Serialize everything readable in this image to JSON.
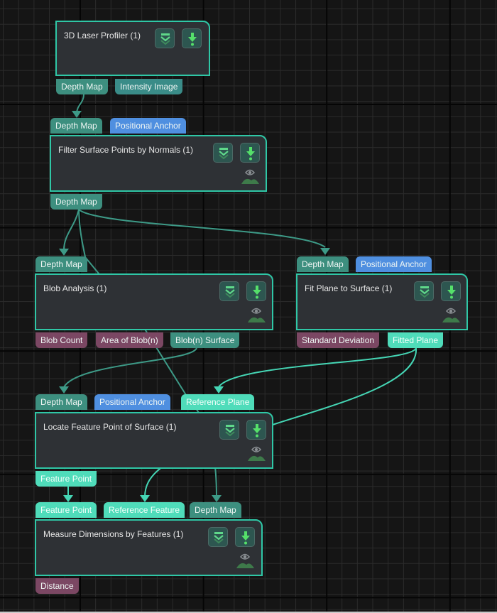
{
  "colors": {
    "background": "#151515",
    "node_fill": "#2e3135",
    "node_border": "#2fc7a6",
    "port_depth_map": "#3d8f7f",
    "port_feature": "#4fdcba",
    "port_anchor": "#4f8fe0",
    "port_numeric": "#7b4763",
    "wire_teal": "#3d9a87",
    "wire_aqua": "#45d6b5"
  },
  "icons": {
    "collapse": "chevrons-down-icon",
    "run": "download-arrow-icon",
    "preview": "eye-image-preview-icon"
  },
  "nodes": [
    {
      "id": "laser",
      "title": "3D Laser Profiler (1)",
      "inputs": [],
      "outputs": [
        "Depth Map",
        "Intensity Image"
      ],
      "has_preview": false
    },
    {
      "id": "filter",
      "title": "Filter Surface Points by Normals (1)",
      "inputs": [
        "Depth Map",
        "Positional Anchor"
      ],
      "outputs": [
        "Depth Map"
      ],
      "has_preview": true
    },
    {
      "id": "blob",
      "title": "Blob Analysis (1)",
      "inputs": [
        "Depth Map"
      ],
      "outputs": [
        "Blob Count",
        "Area of Blob(n)",
        "Blob(n) Surface"
      ],
      "has_preview": true
    },
    {
      "id": "fitplane",
      "title": "Fit Plane to Surface (1)",
      "inputs": [
        "Depth Map",
        "Positional Anchor"
      ],
      "outputs": [
        "Standard Deviation",
        "Fitted Plane"
      ],
      "has_preview": true
    },
    {
      "id": "locate",
      "title": "Locate Feature Point of Surface (1)",
      "inputs": [
        "Depth Map",
        "Positional Anchor",
        "Reference Plane"
      ],
      "outputs": [
        "Feature Point"
      ],
      "has_preview": true
    },
    {
      "id": "measure",
      "title": "Measure Dimensions by Features (1)",
      "inputs": [
        "Feature Point",
        "Reference Feature",
        "Depth Map"
      ],
      "outputs": [
        "Distance"
      ],
      "has_preview": true
    }
  ],
  "connections": [
    {
      "from": "3D Laser Profiler (1) / Depth Map",
      "to": "Filter Surface Points by Normals (1) / Depth Map"
    },
    {
      "from": "Filter Surface Points by Normals (1) / Depth Map",
      "to": "Blob Analysis (1) / Depth Map"
    },
    {
      "from": "Filter Surface Points by Normals (1) / Depth Map",
      "to": "Fit Plane to Surface (1) / Depth Map"
    },
    {
      "from": "Filter Surface Points by Normals (1) / Depth Map",
      "to": "Measure Dimensions by Features (1) / Depth Map"
    },
    {
      "from": "Blob Analysis (1) / Blob(n) Surface",
      "to": "Locate Feature Point of Surface (1) / Depth Map"
    },
    {
      "from": "Fit Plane to Surface (1) / Fitted Plane",
      "to": "Locate Feature Point of Surface (1) / Reference Plane"
    },
    {
      "from": "Fit Plane to Surface (1) / Fitted Plane",
      "to": "Measure Dimensions by Features (1) / Reference Feature"
    },
    {
      "from": "Locate Feature Point of Surface (1) / Feature Point",
      "to": "Measure Dimensions by Features (1) / Feature Point"
    }
  ]
}
